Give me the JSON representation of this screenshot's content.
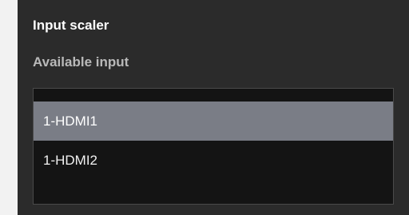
{
  "panel": {
    "title": "Input scaler",
    "section_label": "Available input"
  },
  "available_inputs": {
    "items": [
      {
        "label": "1-HDMI1",
        "selected": true
      },
      {
        "label": "1-HDMI2",
        "selected": false
      }
    ]
  },
  "colors": {
    "panel_background": "#2b2b2b",
    "list_background": "#141414",
    "selected_background": "#7a7d86",
    "title_text": "#ffffff",
    "label_text": "#b9b9b9"
  }
}
